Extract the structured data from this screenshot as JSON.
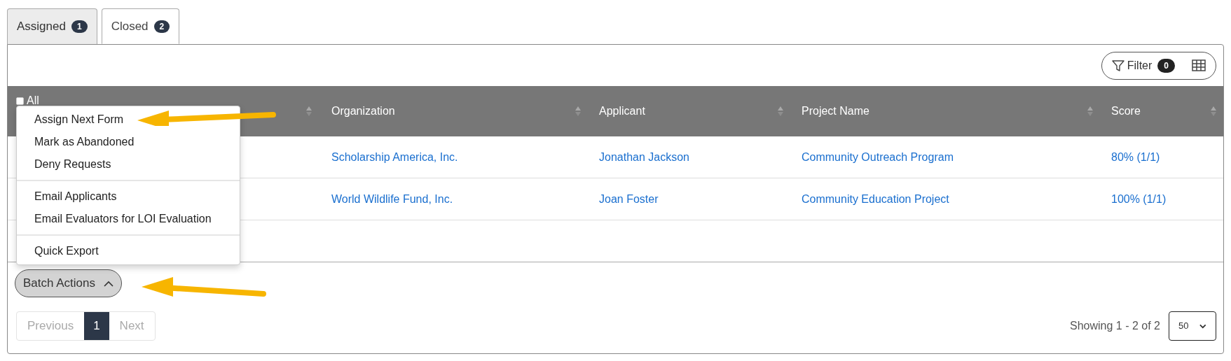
{
  "tabs": [
    {
      "label": "Assigned",
      "count": "1",
      "selected": false
    },
    {
      "label": "Closed",
      "count": "2",
      "selected": true
    }
  ],
  "toolbar": {
    "filter": {
      "label": "Filter",
      "count": "0"
    }
  },
  "table": {
    "select_all": {
      "label": "All",
      "checked": false
    },
    "columns": [
      "Organization",
      "Applicant",
      "Project Name",
      "Score"
    ],
    "rows": [
      {
        "cells": [
          "Scholarship America, Inc.",
          "Jonathan Jackson",
          "Community Outreach Program",
          "80% (1/1)"
        ]
      },
      {
        "cells": [
          "World Wildlife Fund, Inc.",
          "Joan Foster",
          "Community Education Project",
          "100% (1/1)"
        ]
      }
    ]
  },
  "batch_actions": {
    "label": "Batch Actions",
    "expanded": true,
    "groups": [
      [
        "Assign Next Form",
        "Mark as Abandoned",
        "Deny Requests"
      ],
      [
        "Email Applicants",
        "Email Evaluators for LOI Evaluation"
      ],
      [
        "Quick Export"
      ]
    ]
  },
  "pagination": {
    "previous": {
      "label": "Previous",
      "disabled": true
    },
    "pages": [
      {
        "label": "1",
        "selected": true
      }
    ],
    "next": {
      "label": "Next",
      "disabled": true
    },
    "summary": "Showing 1 - 2 of 2",
    "page_size": "50"
  }
}
